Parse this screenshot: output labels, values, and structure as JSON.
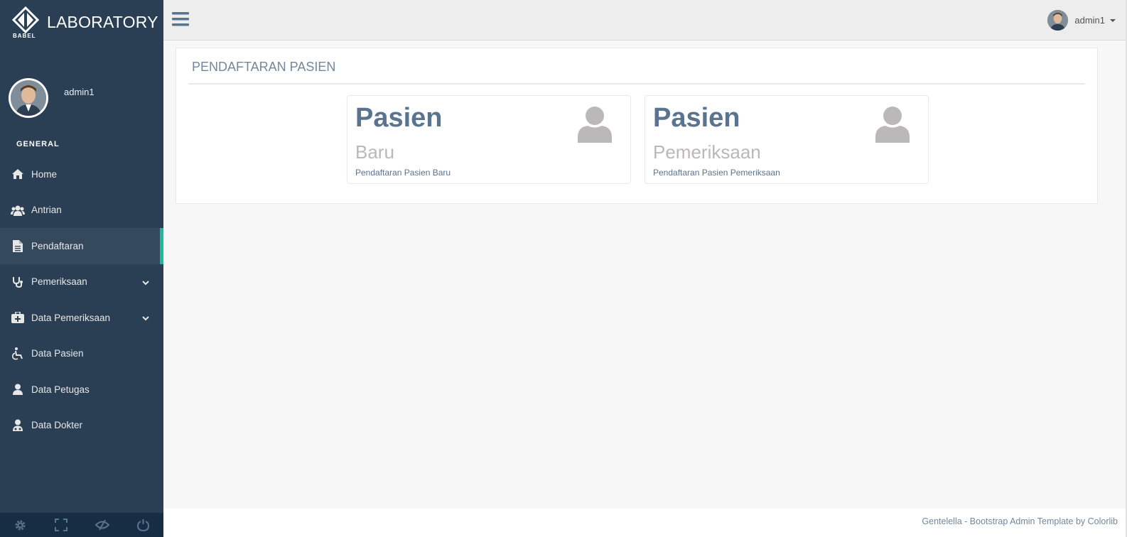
{
  "brand": {
    "title": "LABORATORY",
    "logo_text": "BABEL"
  },
  "profile": {
    "name": "admin1"
  },
  "sidebar": {
    "section": "GENERAL",
    "items": [
      {
        "label": "Home",
        "icon": "home-icon"
      },
      {
        "label": "Antrian",
        "icon": "users-icon"
      },
      {
        "label": "Pendaftaran",
        "icon": "document-icon",
        "active": true
      },
      {
        "label": "Pemeriksaan",
        "icon": "stethoscope-icon",
        "expandable": true
      },
      {
        "label": "Data Pemeriksaan",
        "icon": "medkit-icon",
        "expandable": true
      },
      {
        "label": "Data Pasien",
        "icon": "wheelchair-icon"
      },
      {
        "label": "Data Petugas",
        "icon": "user-icon"
      },
      {
        "label": "Data Dokter",
        "icon": "doctor-icon"
      }
    ],
    "footer_icons": [
      "gear-icon",
      "fullscreen-icon",
      "eye-slash-icon",
      "power-icon"
    ]
  },
  "topnav": {
    "user": "admin1"
  },
  "panel": {
    "title": "PENDAFTARAN PASIEN",
    "tiles": [
      {
        "heading": "Pasien",
        "sub": "Baru",
        "desc": "Pendaftaran Pasien Baru",
        "icon": "user-icon"
      },
      {
        "heading": "Pasien",
        "sub": "Pemeriksaan",
        "desc": "Pendaftaran Pasien Pemeriksaan",
        "icon": "user-icon"
      }
    ]
  },
  "footer": {
    "text": "Gentelella - Bootstrap Admin Template by Colorlib"
  },
  "colors": {
    "sidebar": "#2A3F54",
    "accent": "#1ABB9C",
    "tile_heading": "#5A738E"
  }
}
